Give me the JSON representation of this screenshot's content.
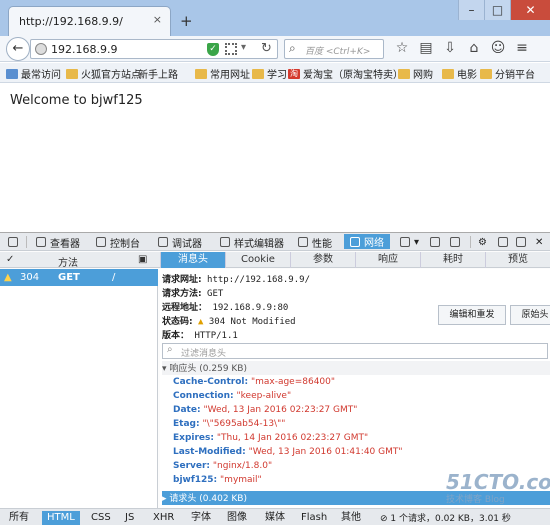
{
  "browser": {
    "tab_title": "http://192.168.9.9/",
    "tab_close": "×",
    "new_tab": "+",
    "win_min": "–",
    "win_max": "□",
    "win_close": "✕",
    "url": "192.168.9.9",
    "search_placeholder": "百度 <Ctrl+K>"
  },
  "bookmarks": [
    {
      "label": "最常访问"
    },
    {
      "label": "火狐官方站点"
    },
    {
      "label": "新手上路"
    },
    {
      "label": "常用网址"
    },
    {
      "label": "学习"
    },
    {
      "label": "爱淘宝（原淘宝特卖）"
    },
    {
      "label": "网购"
    },
    {
      "label": "电影"
    },
    {
      "label": "分销平台"
    }
  ],
  "page": {
    "heading": "Welcome to bjwf125"
  },
  "devtools": {
    "tools": [
      {
        "label": "查看器"
      },
      {
        "label": "控制台"
      },
      {
        "label": "调试器"
      },
      {
        "label": "样式编辑器"
      },
      {
        "label": "性能"
      },
      {
        "label": "网络"
      }
    ],
    "list_columns": {
      "check": "✓",
      "method": "方法",
      "file": "文件图标"
    },
    "detail_tabs": [
      "消息头",
      "Cookie",
      "参数",
      "响应",
      "耗时",
      "预览"
    ],
    "request": {
      "status": "304",
      "method": "GET",
      "file": "/"
    },
    "summary": {
      "url_label": "请求网址:",
      "url": "http://192.168.9.9/",
      "method_label": "请求方法:",
      "method": "GET",
      "remote_label": "远程地址：",
      "remote": "192.168.9.9:80",
      "status_label": "状态码:",
      "status": "304 Not Modified",
      "version_label": "版本：",
      "version": "HTTP/1.1"
    },
    "buttons": {
      "edit_resend": "编辑和重发",
      "raw_headers": "原始头"
    },
    "filter_placeholder": "过滤消息头",
    "response_section": "响应头 (0.259 KB)",
    "response_headers": [
      {
        "key": "Cache-Control:",
        "value": "\"max-age=86400\""
      },
      {
        "key": "Connection:",
        "value": "\"keep-alive\""
      },
      {
        "key": "Date:",
        "value": "\"Wed, 13 Jan 2016 02:23:27 GMT\""
      },
      {
        "key": "Etag:",
        "value": "\"\\\"5695ab54-13\\\"\""
      },
      {
        "key": "Expires:",
        "value": "\"Thu, 14 Jan 2016 02:23:27 GMT\""
      },
      {
        "key": "Last-Modified:",
        "value": "\"Wed, 13 Jan 2016 01:41:40 GMT\""
      },
      {
        "key": "Server:",
        "value": "\"nginx/1.8.0\""
      },
      {
        "key": "bjwf125:",
        "value": "\"mymail\""
      }
    ],
    "request_section": "请求头 (0.402 KB)",
    "filters": [
      "所有",
      "HTML",
      "CSS",
      "JS",
      "XHR",
      "字体",
      "图像",
      "媒体",
      "Flash",
      "其他"
    ],
    "status_summary": "1 个请求，0.02 KB，3.01 秒"
  },
  "watermark": {
    "big": "51CTO.com",
    "small": "技术博客 Blog"
  }
}
